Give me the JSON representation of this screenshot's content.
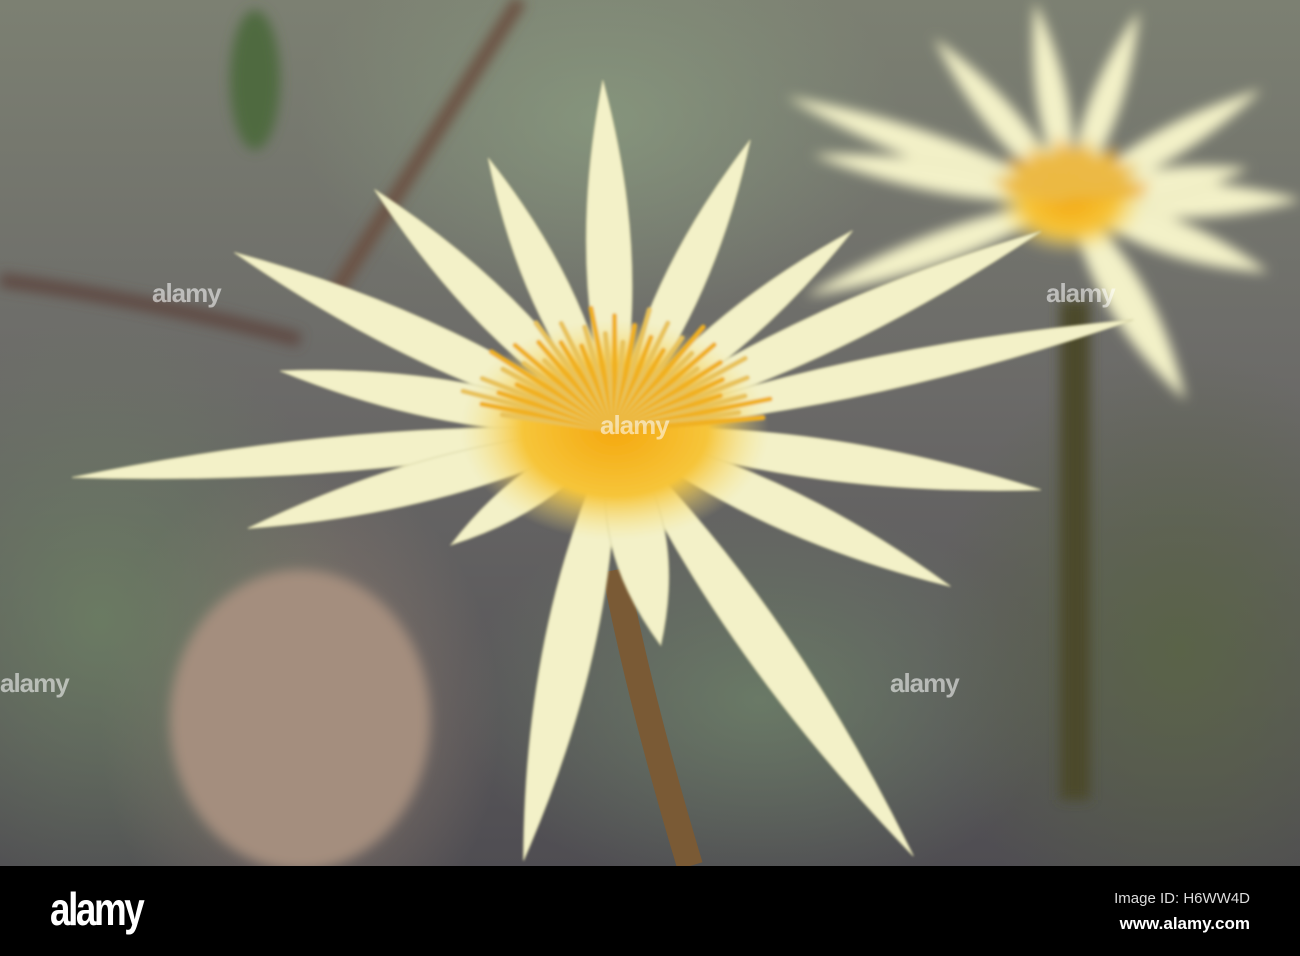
{
  "watermark": {
    "text": "alamy"
  },
  "footer": {
    "logo": "alamy",
    "image_id": "Image ID: H6WW4D",
    "url": "www.alamy.com"
  },
  "colors": {
    "petal": "#f3f1c8",
    "center": "#f2b521",
    "stem": "#7a5a35"
  }
}
